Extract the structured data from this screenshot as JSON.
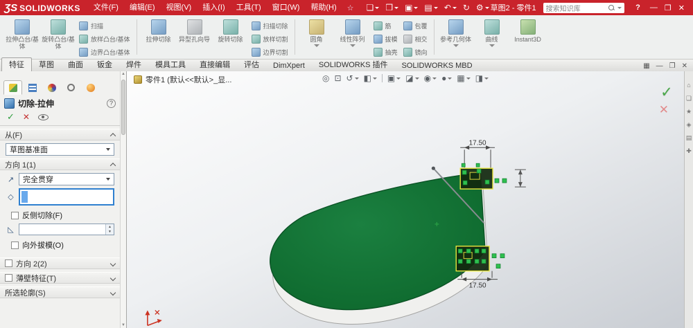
{
  "colors": {
    "titlebar_red": "#c9232b",
    "model_green": "#11722f",
    "selection_blue": "#2f80d0",
    "preview_yellow": "#e9e73f",
    "handle_green": "#2fbf4f"
  },
  "titlebar": {
    "logo_mark": "ƷS",
    "logo_text": "SOLIDWORKS",
    "menus": [
      "文件(F)",
      "编辑(E)",
      "视图(V)",
      "插入(I)",
      "工具(T)",
      "窗口(W)",
      "帮助(H)"
    ],
    "doc_label": "草图2 - 零件1",
    "search_placeholder": "搜索知识库"
  },
  "icons": {
    "pin": "☆",
    "new": "❏",
    "open": "❒",
    "save": "▣",
    "print": "▤",
    "undo": "↶",
    "rebuild": "↻",
    "options": "⚙",
    "help": "?",
    "win_min": "—",
    "win_restore": "❐",
    "win_close": "✕",
    "tab_panes": "▦",
    "tab_min": "—",
    "tab_restore": "❐",
    "tab_close": "✕",
    "hud": [
      "◎",
      "⊡",
      "↺",
      "◧",
      "▣",
      "◪",
      "◉",
      "●",
      "▦",
      "◨"
    ],
    "confirm_ok": "✓",
    "confirm_cancel": "✕",
    "pm_ok": "✓",
    "pm_cancel": "✕",
    "dir_reverse": "↗",
    "edge_select": "◇",
    "draft": "◺",
    "spin_up": "▲",
    "spin_down": "▼",
    "taskpane": [
      "⌂",
      "❏",
      "★",
      "◈",
      "▤",
      "✚"
    ]
  },
  "ribbon": {
    "big": [
      "拉伸凸台/基体",
      "旋转凸台/基体",
      "拉伸切除",
      "异型孔向导",
      "旋转切除",
      "圆角",
      "线性阵列",
      "参考几何体",
      "曲线",
      "Instant3D"
    ],
    "small": [
      "扫描",
      "放样凸台/基体",
      "边界凸台/基体",
      "扫描切除",
      "放样切割",
      "边界切割",
      "筋",
      "拔模",
      "抽壳",
      "包覆",
      "相交",
      "镜向"
    ]
  },
  "tabs": [
    "特征",
    "草图",
    "曲面",
    "钣金",
    "焊件",
    "模具工具",
    "直接编辑",
    "评估",
    "DimXpert",
    "SOLIDWORKS 插件",
    "SOLIDWORKS MBD"
  ],
  "panel": {
    "title": "切除-拉伸",
    "from_label": "从(F)",
    "from_value": "草图基准面",
    "dir1_label": "方向 1(1)",
    "dir1_value": "完全贯穿",
    "flip_side_label": "反侧切除(F)",
    "draft_outward_label": "向外拔模(O)",
    "dir2_label": "方向 2(2)",
    "thin_label": "薄壁特征(T)",
    "contours_label": "所选轮廓(S)"
  },
  "viewport": {
    "doc_tab": "零件1 (默认<<默认>_显...",
    "dim_top": "17.50",
    "dim_bottom": "17.50"
  }
}
